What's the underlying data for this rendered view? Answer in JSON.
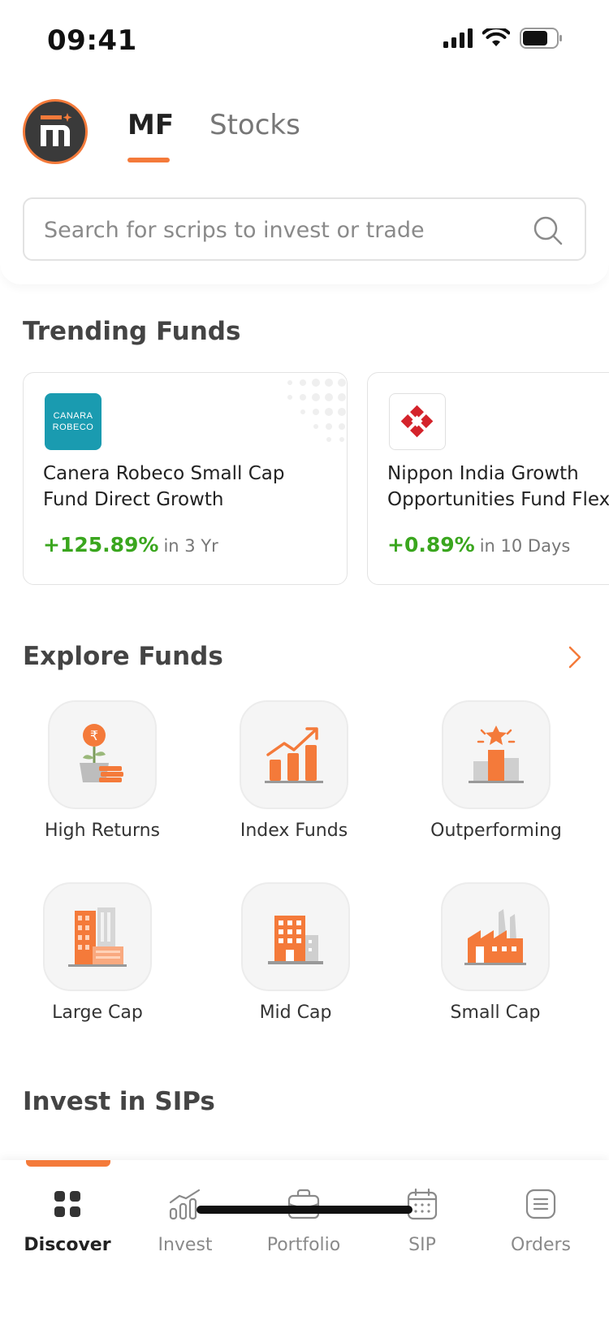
{
  "status_bar": {
    "time": "09:41"
  },
  "header": {
    "tabs": [
      {
        "label": "MF",
        "active": true
      },
      {
        "label": "Stocks",
        "active": false
      }
    ],
    "search": {
      "placeholder": "Search for scrips to invest or trade"
    }
  },
  "trending": {
    "title": "Trending Funds",
    "funds": [
      {
        "logo_text": "CANARA\nROBECO",
        "logo_line1": "CANARA",
        "logo_line2": "ROBECO",
        "name_line1": "Canera Robeco Small Cap",
        "name_line2": "Fund Direct Growth",
        "return": "+125.89%",
        "period": "in 3 Yr"
      },
      {
        "logo_icon": "nippon-logo-icon",
        "name_line1": "Nippon India Growth",
        "name_line2": "Opportunities Fund Flexi",
        "return": "+0.89%",
        "period": "in 10 Days"
      }
    ]
  },
  "explore": {
    "title": "Explore Funds",
    "items": [
      {
        "label": "High Returns",
        "icon": "money-plant-icon"
      },
      {
        "label": "Index Funds",
        "icon": "growth-chart-icon"
      },
      {
        "label": "Outperforming",
        "icon": "podium-star-icon"
      },
      {
        "label": "Large Cap",
        "icon": "large-buildings-icon"
      },
      {
        "label": "Mid Cap",
        "icon": "mid-building-icon"
      },
      {
        "label": "Small Cap",
        "icon": "factory-icon"
      }
    ]
  },
  "sips": {
    "title": "Invest in SIPs"
  },
  "bottom_nav": {
    "items": [
      {
        "label": "Discover",
        "icon": "grid-icon",
        "active": true
      },
      {
        "label": "Invest",
        "icon": "bar-growth-icon",
        "active": false
      },
      {
        "label": "Portfolio",
        "icon": "briefcase-icon",
        "active": false
      },
      {
        "label": "SIP",
        "icon": "calendar-icon",
        "active": false
      },
      {
        "label": "Orders",
        "icon": "orders-list-icon",
        "active": false
      }
    ]
  },
  "colors": {
    "accent": "#f47a3a",
    "positive": "#3aa61e",
    "canara_teal": "#1a9bb0"
  }
}
